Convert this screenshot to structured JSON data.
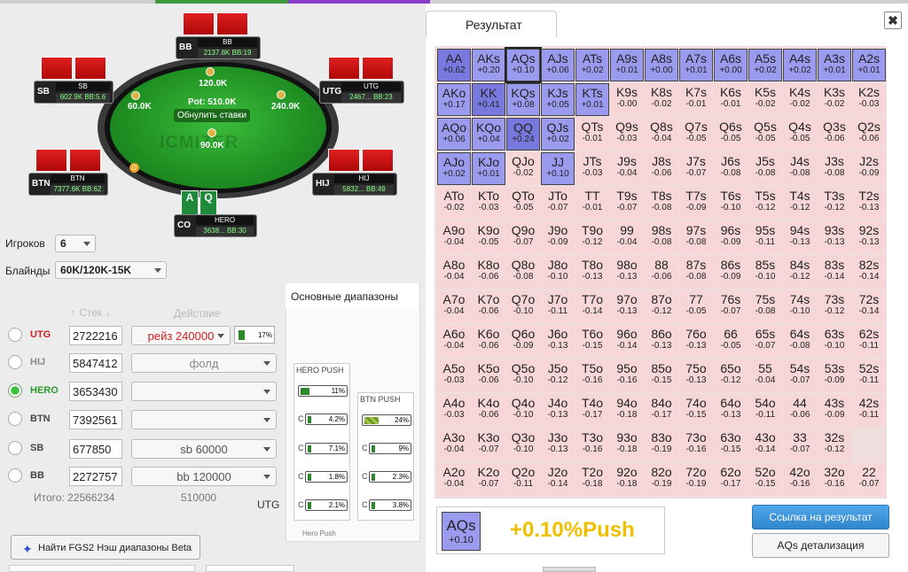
{
  "table": {
    "pot": "Pot: 510.0K",
    "reset_bets": "Обнулить ставки",
    "watermark": "ICMIZER",
    "dealer": "D",
    "bets": {
      "bb": "120.0K",
      "sb": "60.0K",
      "utg": "240.0K",
      "hero": "90.0K"
    },
    "seats": {
      "bb": {
        "pos": "BB",
        "name": "BB",
        "stack": "2137.8K BB:19"
      },
      "sb": {
        "pos": "SB",
        "name": "SB",
        "stack": "602.9K BB:5.6"
      },
      "utg": {
        "pos": "UTG",
        "name": "UTG",
        "stack": "2467... BB:23"
      },
      "btn": {
        "pos": "BTN",
        "name": "BTN",
        "stack": "7377.6K BB:62"
      },
      "hij": {
        "pos": "HIJ",
        "name": "HIJ",
        "stack": "5832... BB:49"
      },
      "hero": {
        "pos": "CO",
        "name": "HERO",
        "stack": "3638... BB:30"
      }
    },
    "hero_cards": [
      "A",
      "Q"
    ]
  },
  "settings": {
    "players_label": "Игроков",
    "players_value": "6",
    "blinds_label": "Блайнды",
    "blinds_value": "60K/120K-15K"
  },
  "players_table": {
    "stack_header": "↑ Стек ↓",
    "action_header": "Действие",
    "rows": [
      {
        "pos": "UTG",
        "stack": "2722216",
        "action": "рейз 240000",
        "pct": "17%"
      },
      {
        "pos": "HIJ",
        "stack": "5847412",
        "action": "фолд"
      },
      {
        "pos": "HERO",
        "stack": "3653430",
        "action": ""
      },
      {
        "pos": "BTN",
        "stack": "7392561",
        "action": ""
      },
      {
        "pos": "SB",
        "stack": "677850",
        "action": "sb 60000"
      },
      {
        "pos": "BB",
        "stack": "2272757",
        "action": "bb 120000"
      }
    ],
    "total_label": "Итого: 22566234",
    "total_action": "510000",
    "utg_label": "UTG"
  },
  "fgs_button": "Найти FGS2 Нэш диапазоны Beta",
  "ranges": {
    "tab": "Основные диапазоны",
    "hero_push": {
      "title": "HERO PUSH",
      "main": "11%",
      "rows": [
        {
          "c": "C",
          "v": "4.2%"
        },
        {
          "c": "C",
          "v": "7.1%"
        },
        {
          "c": "C",
          "v": "1.8%"
        },
        {
          "c": "C",
          "v": "2.1%"
        }
      ]
    },
    "btn_push": {
      "title": "BTN PUSH",
      "main": "24%",
      "rows": [
        {
          "c": "C",
          "v": "9%"
        },
        {
          "c": "C",
          "v": "2.3%"
        },
        {
          "c": "C",
          "v": "3.8%"
        }
      ]
    },
    "footer": "Hero Push"
  },
  "result": {
    "tab": "Результат",
    "close": "✖",
    "grid": [
      [
        [
          "AA",
          "+0.62"
        ],
        [
          "AKs",
          "+0.20"
        ],
        [
          "AQs",
          "+0.10"
        ],
        [
          "AJs",
          "+0.06"
        ],
        [
          "ATs",
          "+0.02"
        ],
        [
          "A9s",
          "+0.01"
        ],
        [
          "A8s",
          "+0.00"
        ],
        [
          "A7s",
          "+0.01"
        ],
        [
          "A6s",
          "+0.00"
        ],
        [
          "A5s",
          "+0.02"
        ],
        [
          "A4s",
          "+0.02"
        ],
        [
          "A3s",
          "+0.01"
        ],
        [
          "A2s",
          "+0.01"
        ]
      ],
      [
        [
          "AKo",
          "+0.17"
        ],
        [
          "KK",
          "+0.41"
        ],
        [
          "KQs",
          "+0.08"
        ],
        [
          "KJs",
          "+0.05"
        ],
        [
          "KTs",
          "+0.01"
        ],
        [
          "K9s",
          "-0.00"
        ],
        [
          "K8s",
          "-0.02"
        ],
        [
          "K7s",
          "-0.01"
        ],
        [
          "K6s",
          "-0.01"
        ],
        [
          "K5s",
          "-0.02"
        ],
        [
          "K4s",
          "-0.02"
        ],
        [
          "K3s",
          "-0.02"
        ],
        [
          "K2s",
          "-0.03"
        ]
      ],
      [
        [
          "AQo",
          "+0.06"
        ],
        [
          "KQo",
          "+0.04"
        ],
        [
          "QQ",
          "+0.24"
        ],
        [
          "QJs",
          "+0.02"
        ],
        [
          "QTs",
          "-0.01"
        ],
        [
          "Q9s",
          "-0.03"
        ],
        [
          "Q8s",
          "-0.04"
        ],
        [
          "Q7s",
          "-0.05"
        ],
        [
          "Q6s",
          "-0.05"
        ],
        [
          "Q5s",
          "-0.05"
        ],
        [
          "Q4s",
          "-0.05"
        ],
        [
          "Q3s",
          "-0.06"
        ],
        [
          "Q2s",
          "-0.06"
        ]
      ],
      [
        [
          "AJo",
          "+0.02"
        ],
        [
          "KJo",
          "+0.01"
        ],
        [
          "QJo",
          "-0.02"
        ],
        [
          "JJ",
          "+0.10"
        ],
        [
          "JTs",
          "-0.03"
        ],
        [
          "J9s",
          "-0.04"
        ],
        [
          "J8s",
          "-0.06"
        ],
        [
          "J7s",
          "-0.07"
        ],
        [
          "J6s",
          "-0.08"
        ],
        [
          "J5s",
          "-0.08"
        ],
        [
          "J4s",
          "-0.08"
        ],
        [
          "J3s",
          "-0.08"
        ],
        [
          "J2s",
          "-0.09"
        ]
      ],
      [
        [
          "ATo",
          "-0.02"
        ],
        [
          "KTo",
          "-0.03"
        ],
        [
          "QTo",
          "-0.05"
        ],
        [
          "JTo",
          "-0.07"
        ],
        [
          "TT",
          "-0.01"
        ],
        [
          "T9s",
          "-0.07"
        ],
        [
          "T8s",
          "-0.08"
        ],
        [
          "T7s",
          "-0.09"
        ],
        [
          "T6s",
          "-0.10"
        ],
        [
          "T5s",
          "-0.12"
        ],
        [
          "T4s",
          "-0.12"
        ],
        [
          "T3s",
          "-0.12"
        ],
        [
          "T2s",
          "-0.13"
        ]
      ],
      [
        [
          "A9o",
          "-0.04"
        ],
        [
          "K9o",
          "-0.05"
        ],
        [
          "Q9o",
          "-0.07"
        ],
        [
          "J9o",
          "-0.09"
        ],
        [
          "T9o",
          "-0.12"
        ],
        [
          "99",
          "-0.04"
        ],
        [
          "98s",
          "-0.08"
        ],
        [
          "97s",
          "-0.08"
        ],
        [
          "96s",
          "-0.09"
        ],
        [
          "95s",
          "-0.11"
        ],
        [
          "94s",
          "-0.13"
        ],
        [
          "93s",
          "-0.13"
        ],
        [
          "92s",
          "-0.13"
        ]
      ],
      [
        [
          "A8o",
          "-0.04"
        ],
        [
          "K8o",
          "-0.06"
        ],
        [
          "Q8o",
          "-0.08"
        ],
        [
          "J8o",
          "-0.10"
        ],
        [
          "T8o",
          "-0.13"
        ],
        [
          "98o",
          "-0.13"
        ],
        [
          "88",
          "-0.06"
        ],
        [
          "87s",
          "-0.08"
        ],
        [
          "86s",
          "-0.09"
        ],
        [
          "85s",
          "-0.10"
        ],
        [
          "84s",
          "-0.12"
        ],
        [
          "83s",
          "-0.14"
        ],
        [
          "82s",
          "-0.14"
        ]
      ],
      [
        [
          "A7o",
          "-0.04"
        ],
        [
          "K7o",
          "-0.06"
        ],
        [
          "Q7o",
          "-0.10"
        ],
        [
          "J7o",
          "-0.11"
        ],
        [
          "T7o",
          "-0.14"
        ],
        [
          "97o",
          "-0.13"
        ],
        [
          "87o",
          "-0.12"
        ],
        [
          "77",
          "-0.05"
        ],
        [
          "76s",
          "-0.07"
        ],
        [
          "75s",
          "-0.08"
        ],
        [
          "74s",
          "-0.10"
        ],
        [
          "73s",
          "-0.12"
        ],
        [
          "72s",
          "-0.14"
        ]
      ],
      [
        [
          "A6o",
          "-0.04"
        ],
        [
          "K6o",
          "-0.06"
        ],
        [
          "Q6o",
          "-0.09"
        ],
        [
          "J6o",
          "-0.13"
        ],
        [
          "T6o",
          "-0.15"
        ],
        [
          "96o",
          "-0.14"
        ],
        [
          "86o",
          "-0.13"
        ],
        [
          "76o",
          "-0.13"
        ],
        [
          "66",
          "-0.05"
        ],
        [
          "65s",
          "-0.07"
        ],
        [
          "64s",
          "-0.08"
        ],
        [
          "63s",
          "-0.10"
        ],
        [
          "62s",
          "-0.11"
        ]
      ],
      [
        [
          "A5o",
          "-0.03"
        ],
        [
          "K5o",
          "-0.06"
        ],
        [
          "Q5o",
          "-0.10"
        ],
        [
          "J5o",
          "-0.12"
        ],
        [
          "T5o",
          "-0.16"
        ],
        [
          "95o",
          "-0.16"
        ],
        [
          "85o",
          "-0.15"
        ],
        [
          "75o",
          "-0.13"
        ],
        [
          "65o",
          "-0.12"
        ],
        [
          "55",
          "-0.04"
        ],
        [
          "54s",
          "-0.07"
        ],
        [
          "53s",
          "-0.09"
        ],
        [
          "52s",
          "-0.11"
        ]
      ],
      [
        [
          "A4o",
          "-0.03"
        ],
        [
          "K4o",
          "-0.06"
        ],
        [
          "Q4o",
          "-0.10"
        ],
        [
          "J4o",
          "-0.13"
        ],
        [
          "T4o",
          "-0.17"
        ],
        [
          "94o",
          "-0.18"
        ],
        [
          "84o",
          "-0.17"
        ],
        [
          "74o",
          "-0.15"
        ],
        [
          "64o",
          "-0.13"
        ],
        [
          "54o",
          "-0.11"
        ],
        [
          "44",
          "-0.06"
        ],
        [
          "43s",
          "-0.09"
        ],
        [
          "42s",
          "-0.11"
        ]
      ],
      [
        [
          "A3o",
          "-0.04"
        ],
        [
          "K3o",
          "-0.07"
        ],
        [
          "Q3o",
          "-0.10"
        ],
        [
          "J3o",
          "-0.13"
        ],
        [
          "T3o",
          "-0.16"
        ],
        [
          "93o",
          "-0.18"
        ],
        [
          "83o",
          "-0.19"
        ],
        [
          "73o",
          "-0.16"
        ],
        [
          "63o",
          "-0.15"
        ],
        [
          "43o",
          "-0.14"
        ],
        [
          "33",
          "-0.07"
        ],
        [
          "32s",
          "-0.12"
        ]
      ],
      [
        [
          "A2o",
          "-0.04"
        ],
        [
          "K2o",
          "-0.07"
        ],
        [
          "Q2o",
          "-0.11"
        ],
        [
          "J2o",
          "-0.14"
        ],
        [
          "T2o",
          "-0.18"
        ],
        [
          "92o",
          "-0.18"
        ],
        [
          "82o",
          "-0.19"
        ],
        [
          "72o",
          "-0.19"
        ],
        [
          "62o",
          "-0.17"
        ],
        [
          "52o",
          "-0.15"
        ],
        [
          "42o",
          "-0.16"
        ],
        [
          "32o",
          "-0.16"
        ],
        [
          "22",
          "-0.07"
        ]
      ]
    ],
    "selected_hand": "AQs",
    "selected_value": "+0.10",
    "result_text": "+0.10%Push",
    "link_button": "Ссылка на результат",
    "detail_button": "AQs детализация"
  }
}
